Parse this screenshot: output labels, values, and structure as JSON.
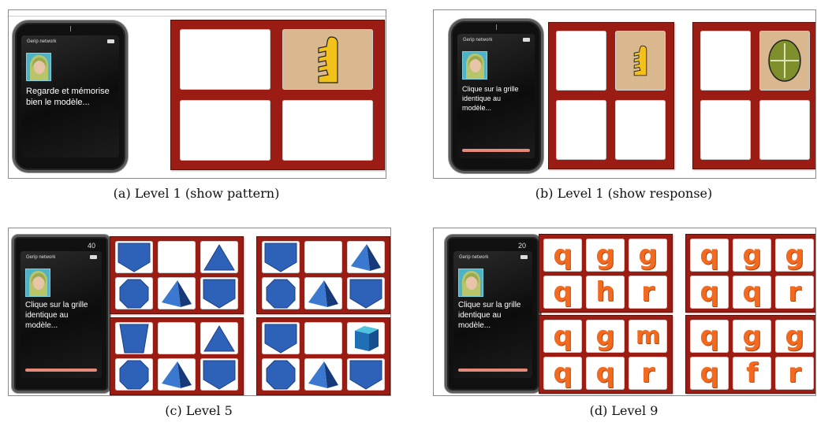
{
  "panels": {
    "a": {
      "caption": "(a) Level 1 (show pattern)",
      "message": "Regarde et mémorise bien le modèle...",
      "network": "Gerip network"
    },
    "b": {
      "caption": "(b) Level 1 (show response)",
      "message": "Clique sur la grille identique au modèle...",
      "network": "Gerip network"
    },
    "c": {
      "caption": "(c) Level 5",
      "message": "Clique sur la grille identique au modèle...",
      "network": "Gerip network",
      "counter": "40"
    },
    "d": {
      "caption": "(d) Level 9",
      "message": "Clique sur la grille identique au modèle...",
      "network": "Gerip network",
      "counter": "20"
    }
  },
  "level9": {
    "grids": [
      [
        "q",
        "g",
        "g",
        "q",
        "h",
        "r"
      ],
      [
        "q",
        "g",
        "g",
        "q",
        "q",
        "r"
      ],
      [
        "q",
        "g",
        "m",
        "q",
        "q",
        "r"
      ],
      [
        "q",
        "g",
        "g",
        "q",
        "f",
        "r"
      ]
    ]
  },
  "colors": {
    "grid_frame": "#9b1c12",
    "shape_blue": "#2d62b8",
    "letter_orange": "#f26a1f",
    "cell_tan": "#d9b78f"
  }
}
